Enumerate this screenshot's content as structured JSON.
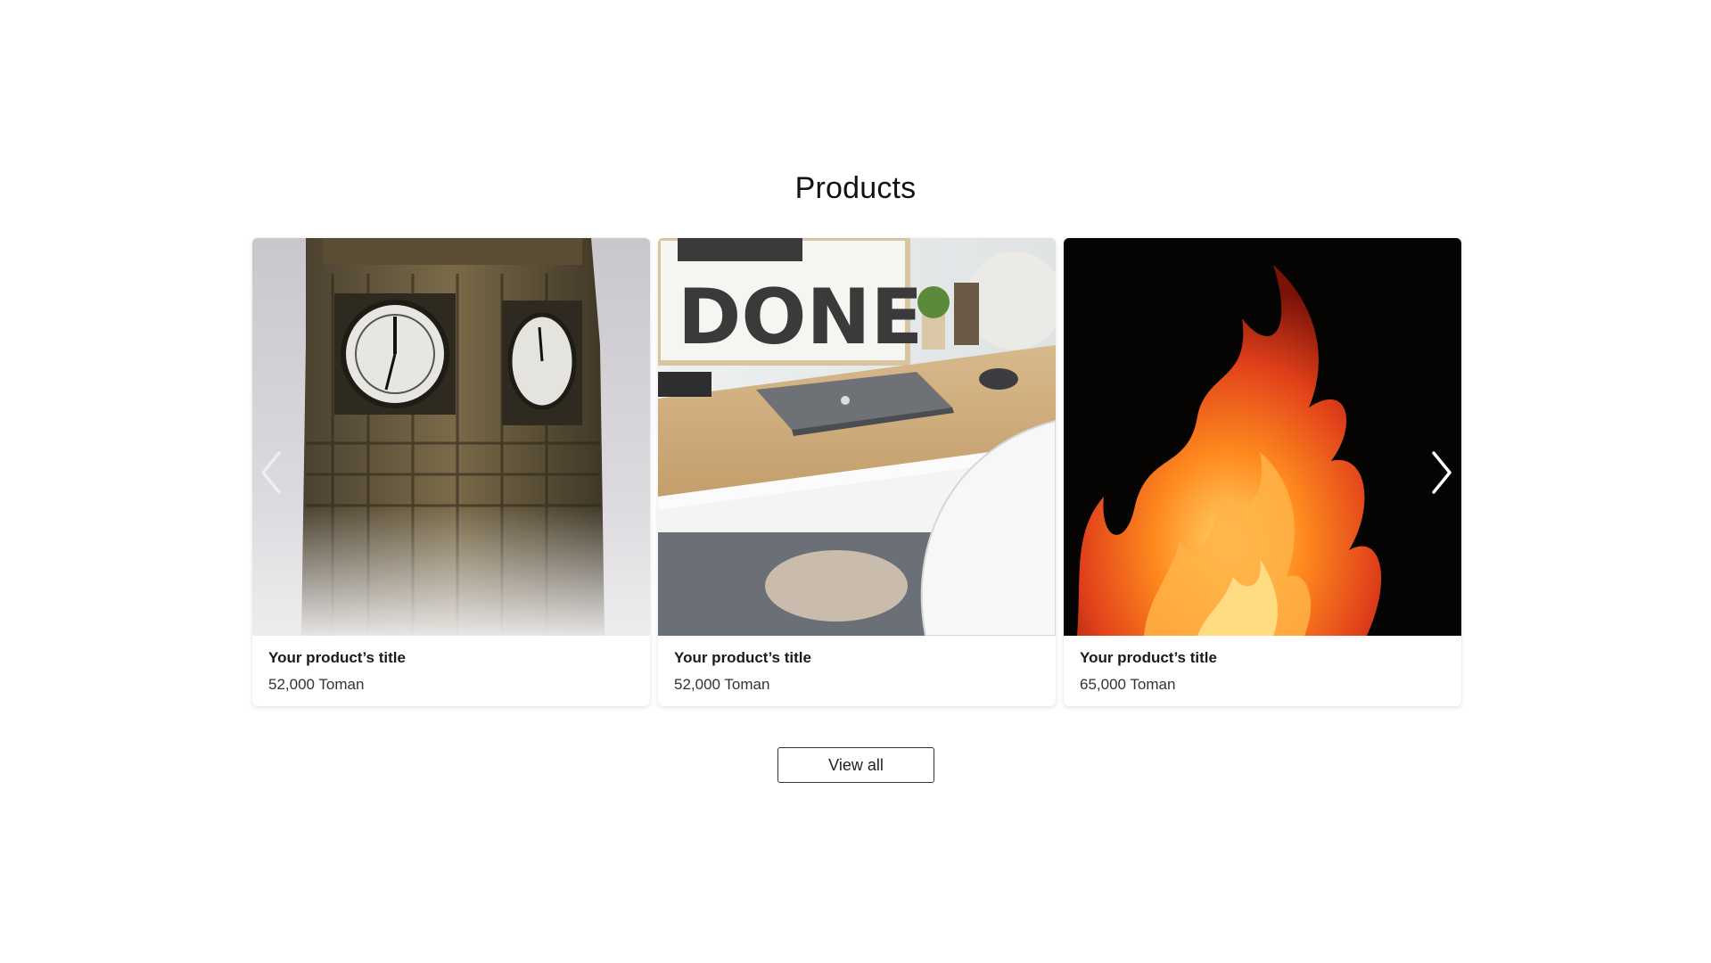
{
  "section": {
    "title": "Products"
  },
  "products": [
    {
      "title": "Your product’s title",
      "price": "52,000 Toman",
      "image_icon": "clock-tower-image"
    },
    {
      "title": "Your product’s title",
      "price": "52,000 Toman",
      "image_icon": "desk-workspace-image",
      "poster_text": "DONE."
    },
    {
      "title": "Your product’s title",
      "price": "65,000 Toman",
      "image_icon": "fire-flames-image"
    }
  ],
  "controls": {
    "prev_icon": "chevron-left-icon",
    "next_icon": "chevron-right-icon",
    "view_all_label": "View all"
  }
}
